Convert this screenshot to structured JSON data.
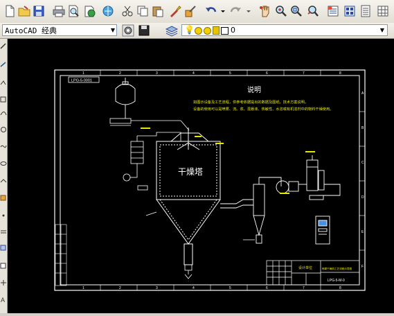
{
  "workspace": {
    "selected": "AutoCAD 经典"
  },
  "layer": {
    "current": "0"
  },
  "toolbar_icons": [
    "new-file-icon",
    "open-file-icon",
    "save-icon",
    "print-icon",
    "print-preview-icon",
    "publish-icon",
    "cut-icon",
    "copy-icon",
    "paste-icon",
    "match-properties-icon",
    "block-editor-icon",
    "undo-icon",
    "redo-icon",
    "pan-icon",
    "zoom-realtime-icon",
    "zoom-window-icon",
    "zoom-previous-icon",
    "properties-icon",
    "design-center-icon",
    "tool-palettes-icon",
    "sheet-set-icon",
    "calculator-icon"
  ],
  "drawing": {
    "notes_title": "说明",
    "notes_line1": "如图示设备及工艺流程，供参考依据提出的数据及图纸，技术方案说明。",
    "notes_line2": "设备的使用可以是喷雾、流、浆、混悬液、热敏性、水溶或有机溶剂中的物料干燥使用。",
    "tower_label": "干燥塔",
    "drawing_number": "LPG-5-M-0",
    "top_tag": "LPG-5-0001",
    "grid_numbers": [
      "1",
      "2",
      "3",
      "4",
      "5",
      "6",
      "7",
      "8"
    ],
    "grid_letters": [
      "A",
      "B",
      "C",
      "D",
      "E",
      "F"
    ],
    "title_block_name": "设计单位",
    "title_block_desc": "喷雾干燥机工艺流程示意图"
  }
}
